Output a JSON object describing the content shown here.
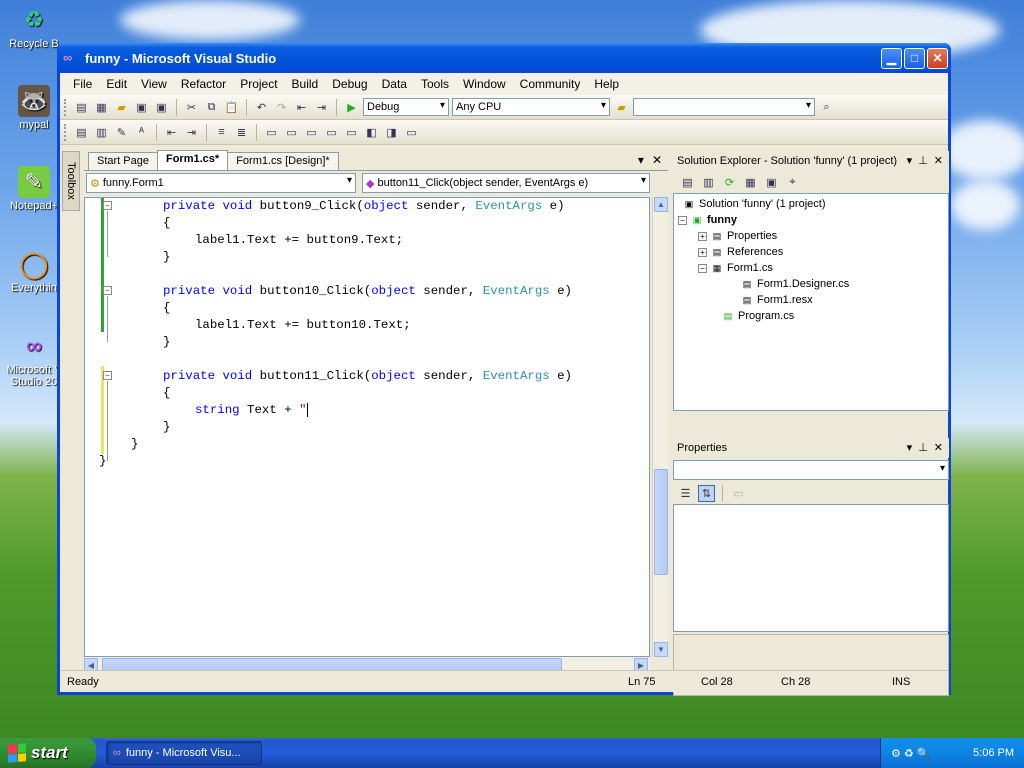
{
  "desktop": {
    "icons": [
      {
        "label": "Recycle B",
        "icon": "recycle-bin-icon"
      },
      {
        "label": "mypal",
        "icon": "mypal-icon"
      },
      {
        "label": "Notepad+",
        "icon": "notepad-icon"
      },
      {
        "label": "Everythin",
        "icon": "everything-icon"
      },
      {
        "label": "Microsoft V Studio 20",
        "icon": "visual-studio-icon"
      }
    ]
  },
  "window": {
    "title": "funny - Microsoft Visual Studio",
    "menu": [
      "File",
      "Edit",
      "View",
      "Refactor",
      "Project",
      "Build",
      "Debug",
      "Data",
      "Tools",
      "Window",
      "Community",
      "Help"
    ],
    "toolbar": {
      "config": "Debug",
      "platform": "Any CPU",
      "find": ""
    },
    "toolbox_label": "Toolbox"
  },
  "editor": {
    "tabs": [
      {
        "label": "Start Page",
        "active": false
      },
      {
        "label": "Form1.cs*",
        "active": true
      },
      {
        "label": "Form1.cs [Design]*",
        "active": false
      }
    ],
    "class_combo": "funny.Form1",
    "member_combo": "button11_Click(object sender, EventArgs e)",
    "code": {
      "l1_kw": "private void",
      "l1_name": " button9_Click(",
      "l1_obj": "object",
      "l1_sender": " sender, ",
      "l1_type": "EventArgs",
      "l1_e": " e)",
      "l2": "{",
      "l3": "label1.Text += button9.Text;",
      "l4": "}",
      "l5_kw": "private void",
      "l5_name": " button10_Click(",
      "l5_obj": "object",
      "l5_sender": " sender, ",
      "l5_type": "EventArgs",
      "l5_e": " e)",
      "l6": "{",
      "l7": "label1.Text += button10.Text;",
      "l8": "}",
      "l9_kw": "private void",
      "l9_name": " button11_Click(",
      "l9_obj": "object",
      "l9_sender": " sender, ",
      "l9_type": "EventArgs",
      "l9_e": " e)",
      "l10": "{",
      "l11_kw": "string",
      "l11_rest": " Text + ",
      "l11_str": "\"",
      "l12": "}",
      "l13": "}",
      "l14": "}"
    }
  },
  "solution_explorer": {
    "title": "Solution Explorer - Solution 'funny' (1 project)",
    "items": [
      {
        "label": "Solution 'funny' (1 project)"
      },
      {
        "label": "funny"
      },
      {
        "label": "Properties"
      },
      {
        "label": "References"
      },
      {
        "label": "Form1.cs"
      },
      {
        "label": "Form1.Designer.cs"
      },
      {
        "label": "Form1.resx"
      },
      {
        "label": "Program.cs"
      }
    ]
  },
  "properties": {
    "title": "Properties"
  },
  "status": {
    "ready": "Ready",
    "ln": "Ln 75",
    "col": "Col 28",
    "ch": "Ch 28",
    "ins": "INS"
  },
  "taskbar": {
    "start": "start",
    "task": "funny - Microsoft Visu...",
    "time": "5:06 PM"
  }
}
